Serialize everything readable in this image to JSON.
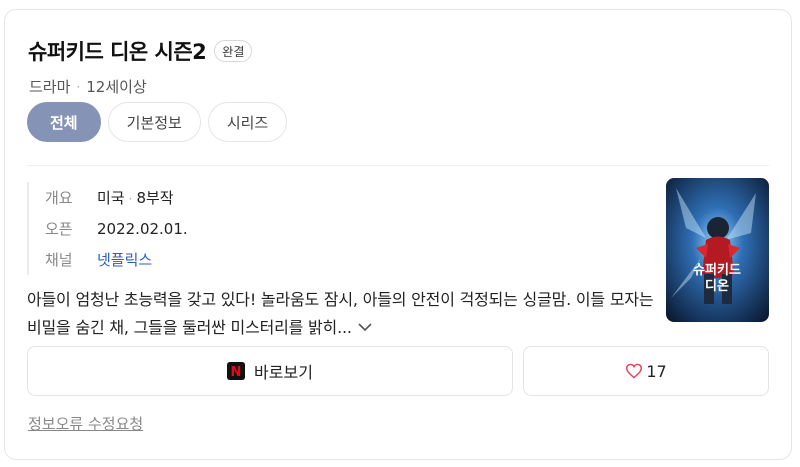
{
  "header": {
    "title": "슈퍼키드 디온 시즌2",
    "status_badge": "완결",
    "genre": "드라마",
    "meta_separator": "·",
    "rating": "12세이상"
  },
  "tabs": [
    {
      "label": "전체",
      "active": true
    },
    {
      "label": "기본정보",
      "active": false
    },
    {
      "label": "시리즈",
      "active": false
    }
  ],
  "info": {
    "overview_label": "개요",
    "country": "미국",
    "separator": "·",
    "episodes": "8부작",
    "open_label": "오픈",
    "open_date": "2022.02.01.",
    "channel_label": "채널",
    "channel": "넷플릭스"
  },
  "synopsis": {
    "text": "아들이 엄청난 초능력을 갖고 있다! 놀라움도 잠시, 아들의 안전이 걱정되는 싱글맘. 이들 모자는 비밀을 숨긴 채, 그들을 둘러싼 미스터리를 밝히...",
    "more_icon": "chevron-down-icon"
  },
  "poster": {
    "title_line1": "슈퍼키드",
    "title_line2": "디온"
  },
  "actions": {
    "watch_label": "바로보기",
    "watch_icon": "netflix-logo-icon",
    "netflix_letter": "N",
    "like_icon": "heart-icon",
    "like_count": "17"
  },
  "footer": {
    "report_link": "정보오류 수정요청"
  },
  "colors": {
    "active_tab": "#8593b6",
    "link": "#2b5dbd",
    "heart": "#e0435c",
    "netflix_red": "#e50914"
  }
}
